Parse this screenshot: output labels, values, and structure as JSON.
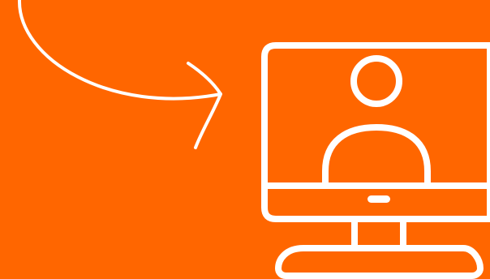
{
  "colors": {
    "background": "#FF6600",
    "stroke": "#FFFFFF"
  },
  "icons": {
    "arrow": "curved-arrow-icon",
    "monitor": "monitor-icon",
    "user": "user-icon"
  }
}
